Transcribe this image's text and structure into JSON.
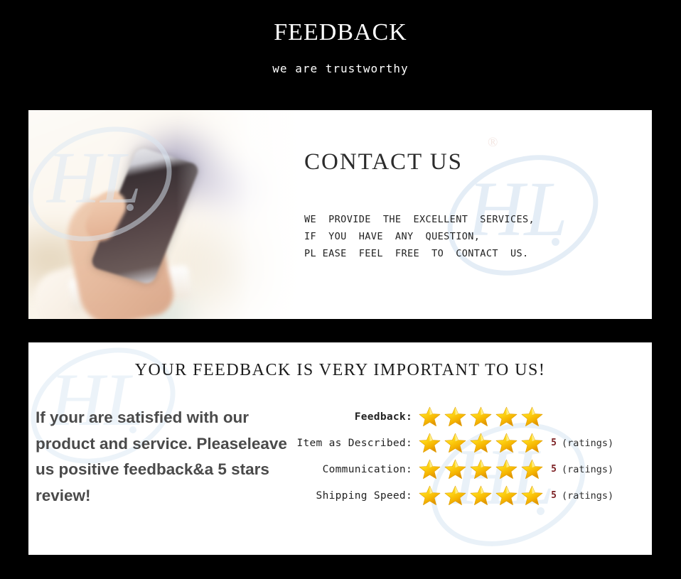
{
  "header": {
    "title": "FEEDBACK",
    "subtitle": "we are trustworthy"
  },
  "contact": {
    "title": "CONTACT  US",
    "reg_symbol": "®",
    "lines": "WE  PROVIDE  THE  EXCELLENT  SERVICES,\nIF  YOU  HAVE  ANY  QUESTION,\nPL EASE  FEEL  FREE  TO  CONTACT  US.",
    "watermark_text": "HL"
  },
  "feedback": {
    "heading": "YOUR FEEDBACK IS VERY IMPORTANT TO US!",
    "promo": "If your are satisfied with our product and service. Pleaseleave us positive feedback&a 5 stars review!",
    "watermark_text": "HL",
    "rows": [
      {
        "label": "Feedback:",
        "stars": 5,
        "count": "",
        "unit": "",
        "bold": true
      },
      {
        "label": "Item as Described:",
        "stars": 5,
        "count": "5",
        "unit": "(ratings)",
        "bold": false
      },
      {
        "label": "Communication:",
        "stars": 5,
        "count": "5",
        "unit": "(ratings)",
        "bold": false
      },
      {
        "label": "Shipping Speed:",
        "stars": 5,
        "count": "5",
        "unit": "(ratings)",
        "bold": false
      }
    ]
  },
  "colors": {
    "background": "#000000",
    "panel": "#ffffff",
    "star_gold": "#ffd700",
    "star_edge": "#e8a200",
    "count_red": "#7b1f22",
    "promo_gray": "#4a4a4a",
    "watermark_blue": "#dbe8f4"
  }
}
